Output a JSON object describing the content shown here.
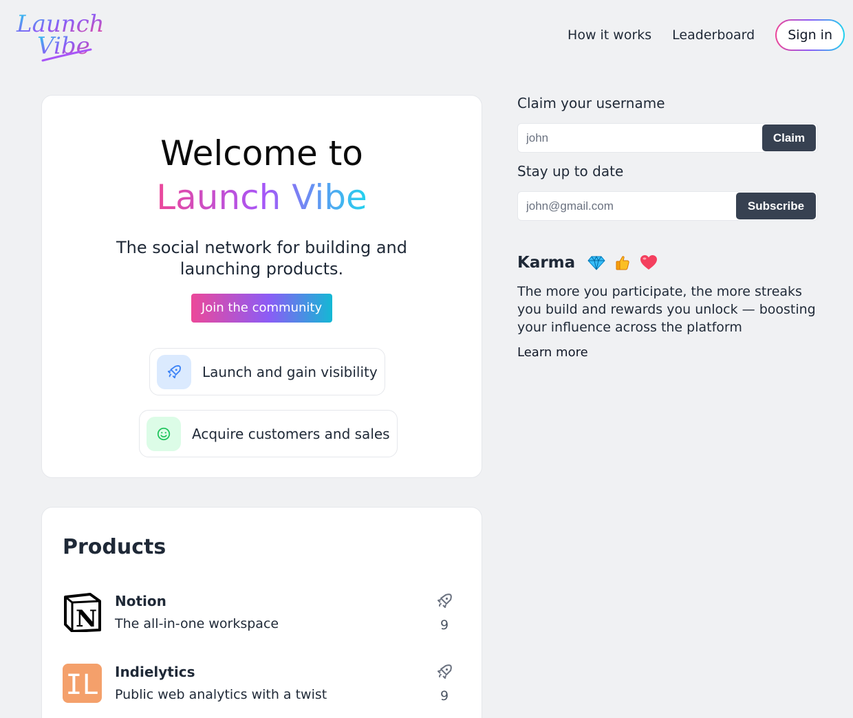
{
  "brand": {
    "logo_line1": "Launch",
    "logo_line2": "Vibe"
  },
  "nav": {
    "links": [
      "How it works",
      "Leaderboard"
    ],
    "signin_label": "Sign in"
  },
  "hero": {
    "title_line1": "Welcome to",
    "title_line2": "Launch Vibe",
    "tagline": "The social network for building and launching products.",
    "cta_label": "Join the community",
    "features": [
      {
        "icon": "rocket-icon",
        "label": "Launch and gain visibility",
        "color": "#3b82f6",
        "bg": "#dbeafe"
      },
      {
        "icon": "smile-icon",
        "label": "Acquire customers and sales",
        "color": "#22c55e",
        "bg": "#dcfce7"
      }
    ]
  },
  "products": {
    "heading": "Products",
    "items": [
      {
        "name": "Notion",
        "description": "The all-in-one workspace",
        "votes": "9",
        "logo_text": "N"
      },
      {
        "name": "Indielytics",
        "description": "Public web analytics with a twist",
        "votes": "9",
        "logo_text": "IL",
        "logo_color": "#f4a06b"
      }
    ]
  },
  "sidebar": {
    "username": {
      "label": "Claim your username",
      "placeholder": "john",
      "button": "Claim"
    },
    "subscribe": {
      "label": "Stay up to date",
      "placeholder": "john@gmail.com",
      "button": "Subscribe"
    },
    "karma": {
      "title": "Karma",
      "icons": [
        "gem-icon",
        "thumbs-up-icon",
        "heart-icon"
      ],
      "text": "The more you participate, the more streaks you build and rewards you unlock — boosting your influence across the platform",
      "link": "Learn more"
    }
  },
  "colors": {
    "accent_pink": "#ec4899",
    "accent_purple": "#8b5cf6",
    "accent_cyan": "#22d3ee",
    "dark_button": "#374151"
  }
}
